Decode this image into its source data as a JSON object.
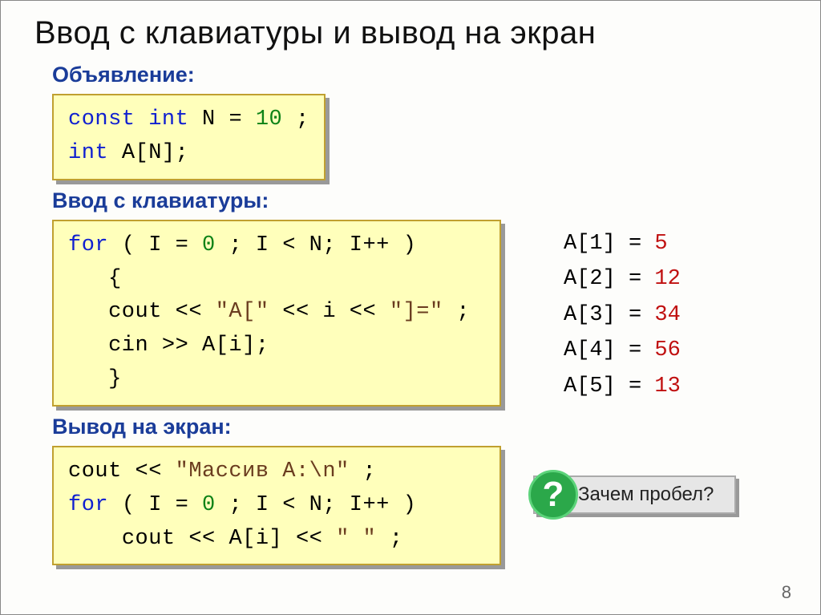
{
  "title": "Ввод с клавиатуры и вывод на экран",
  "sections": {
    "decl": "Объявление:",
    "input": "Ввод с клавиатуры:",
    "output": "Вывод на экран:"
  },
  "code": {
    "decl_const": "const",
    "decl_int1": "int",
    "decl_n": "N",
    "decl_eq": "=",
    "decl_val": "10",
    "decl_semi": ";",
    "decl_int2": "int",
    "decl_arr": "A[N];",
    "for_kw": "for",
    "for_open": "( I",
    "for_eq": "=",
    "for_zero": "0",
    "for_cond": "; I",
    "for_lt": "<",
    "for_n": "N; I++ )",
    "brace_open": "{",
    "cout1": "cout",
    "cout_op": "<<",
    "str1": "\"A[\"",
    "str2": "\"]=\"",
    "ivar": "i",
    "cin": "cin",
    "cin_op": ">>",
    "cin_arr": "A[i];",
    "brace_close": "}",
    "out_cout1": "cout",
    "out_str1": "\"Массив A:\\n\"",
    "out_semi": ";",
    "out_ai": "A[i]",
    "out_space": "\" \""
  },
  "array_values": [
    {
      "label": "A[1]",
      "eq": "=",
      "val": "5"
    },
    {
      "label": "A[2]",
      "eq": "=",
      "val": "12"
    },
    {
      "label": "A[3]",
      "eq": "=",
      "val": "34"
    },
    {
      "label": "A[4]",
      "eq": "=",
      "val": "56"
    },
    {
      "label": "A[5]",
      "eq": "=",
      "val": "13"
    }
  ],
  "callout": {
    "qmark": "?",
    "text": "Зачем пробел?"
  },
  "page_number": "8"
}
